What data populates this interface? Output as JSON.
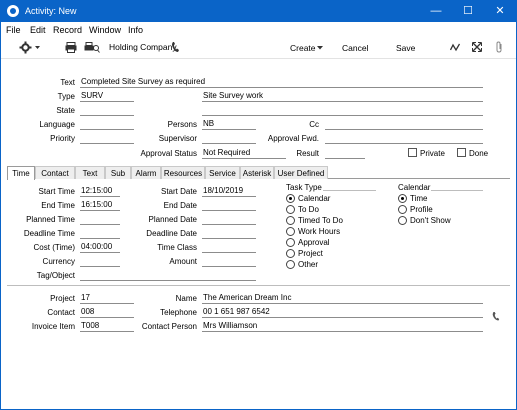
{
  "window": {
    "title": "Activity: New",
    "minimize": "—",
    "maximize": "☐",
    "close": "✕"
  },
  "menu": [
    "File",
    "Edit",
    "Record",
    "Window",
    "Info"
  ],
  "toolbar": {
    "company": "Holding Company",
    "create": "Create",
    "cancel": "Cancel",
    "save": "Save"
  },
  "header": {
    "text_label": "Text",
    "text_value": "Completed Site Survey as required",
    "type_label": "Type",
    "type_value": "SURV",
    "type_desc": "Site Survey work",
    "state_label": "State",
    "state_value": "",
    "language_label": "Language",
    "language_value": "",
    "persons_label": "Persons",
    "persons_value": "NB",
    "cc_label": "Cc",
    "cc_value": "",
    "priority_label": "Priority",
    "priority_value": "",
    "supervisor_label": "Supervisor",
    "supervisor_value": "",
    "approval_fwd_label": "Approval Fwd.",
    "approval_fwd_value": "",
    "approval_status_label": "Approval Status",
    "approval_status_value": "Not Required",
    "result_label": "Result",
    "result_value": "",
    "private_label": "Private",
    "done_label": "Done"
  },
  "tabs": [
    "Time",
    "Contact",
    "Text",
    "Sub",
    "Alarm",
    "Resources",
    "Service",
    "Asterisk",
    "User Defined"
  ],
  "time": {
    "start_time_label": "Start Time",
    "start_time_value": "12:15:00",
    "end_time_label": "End Time",
    "end_time_value": "16:15:00",
    "planned_time_label": "Planned Time",
    "planned_time_value": "",
    "deadline_time_label": "Deadline Time",
    "deadline_time_value": "",
    "cost_time_label": "Cost (Time)",
    "cost_time_value": "04:00:00",
    "currency_label": "Currency",
    "currency_value": "",
    "tag_label": "Tag/Object",
    "tag_value": "",
    "start_date_label": "Start Date",
    "start_date_value": "18/10/2019",
    "end_date_label": "End Date",
    "end_date_value": "",
    "planned_date_label": "Planned Date",
    "planned_date_value": "",
    "deadline_date_label": "Deadline Date",
    "deadline_date_value": "",
    "time_class_label": "Time Class",
    "time_class_value": "",
    "amount_label": "Amount",
    "amount_value": "",
    "task_type_label": "Task Type",
    "task_types": [
      "Calendar",
      "To Do",
      "Timed To Do",
      "Work Hours",
      "Approval",
      "Project",
      "Other"
    ],
    "task_type_selected": "Calendar",
    "calendar_label": "Calendar",
    "calendar_options": [
      "Time",
      "Profile",
      "Don't Show"
    ],
    "calendar_selected": "Time"
  },
  "footer": {
    "project_label": "Project",
    "project_value": "17",
    "contact_label": "Contact",
    "contact_value": "008",
    "invoice_item_label": "Invoice Item",
    "invoice_item_value": "T008",
    "name_label": "Name",
    "name_value": "The American Dream Inc",
    "telephone_label": "Telephone",
    "telephone_value": "00 1 651 987 6542",
    "contact_person_label": "Contact Person",
    "contact_person_value": "Mrs Williamson"
  },
  "colors": {
    "titlebar": "#0a64c8"
  }
}
